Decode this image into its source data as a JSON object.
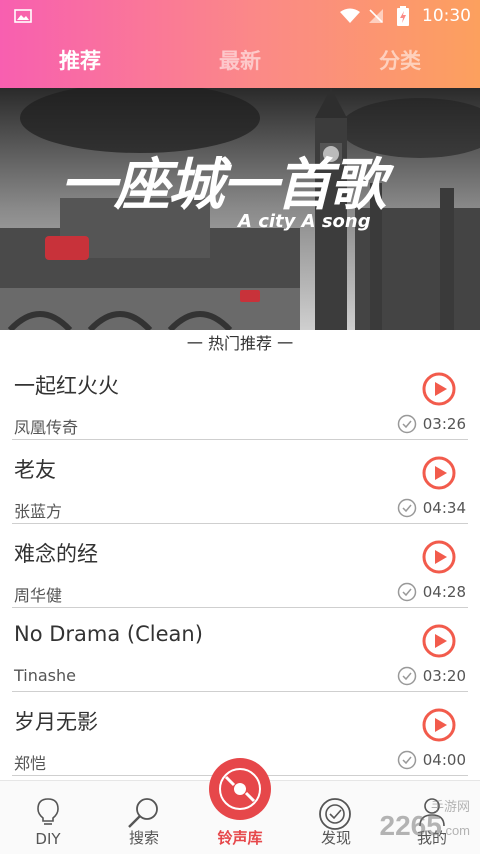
{
  "status_bar": {
    "time": "10:30"
  },
  "tabs": [
    {
      "label": "推荐",
      "active": true
    },
    {
      "label": "最新",
      "active": false
    },
    {
      "label": "分类",
      "active": false
    }
  ],
  "banner": {
    "title": "一座城一首歌",
    "subtitle": "A city A song"
  },
  "section": {
    "title": "一 热门推荐 一"
  },
  "songs": [
    {
      "title": "一起红火火",
      "artist": "凤凰传奇",
      "duration": "03:26"
    },
    {
      "title": "老友",
      "artist": "张蓝方",
      "duration": "04:34"
    },
    {
      "title": "难念的经",
      "artist": "周华健",
      "duration": "04:28"
    },
    {
      "title": "No Drama (Clean)",
      "artist": "Tinashe",
      "duration": "03:20"
    },
    {
      "title": "岁月无影",
      "artist": "郑恺",
      "duration": "04:00"
    }
  ],
  "bottom_nav": [
    {
      "label": "DIY",
      "icon": "lightbulb-icon"
    },
    {
      "label": "搜索",
      "icon": "search-icon"
    },
    {
      "label": "铃声库",
      "icon": "disc-icon",
      "active": true
    },
    {
      "label": "发现",
      "icon": "compass-icon"
    },
    {
      "label": "我的",
      "icon": "user-icon"
    }
  ],
  "watermark": {
    "text": "2265",
    "suffix": ".com",
    "sub": "手游网"
  },
  "colors": {
    "accent_pink": "#f85fb0",
    "accent_orange": "#fca05e",
    "play_red": "#f25b4c",
    "active_nav": "#e6474a"
  }
}
